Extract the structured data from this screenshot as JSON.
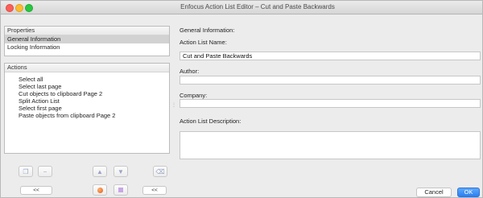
{
  "window": {
    "title": "Enfocus Action List Editor – Cut and Paste Backwards"
  },
  "properties": {
    "header": "Properties",
    "items": [
      "General Information",
      "Locking Information"
    ],
    "selected_index": 0
  },
  "actions": {
    "header": "Actions",
    "items": [
      "Select all",
      "Select last page",
      "Cut objects to clipboard Page 2",
      "Split Action List",
      "Select first page",
      "Paste objects from clipboard Page 2"
    ]
  },
  "toolbar": {
    "collapse_left_label": "<<",
    "collapse_right_label": "<<"
  },
  "general": {
    "section_title": "General Information:",
    "name_label": "Action List Name:",
    "name_value": "Cut and Paste Backwards",
    "author_label": "Author:",
    "author_value": "",
    "company_label": "Company:",
    "company_value": "",
    "description_label": "Action List Description:",
    "description_value": ""
  },
  "footer": {
    "cancel_label": "Cancel",
    "ok_label": "OK"
  },
  "colors": {
    "accent": "#2b7ff3",
    "selection": "#d2d2d2"
  }
}
